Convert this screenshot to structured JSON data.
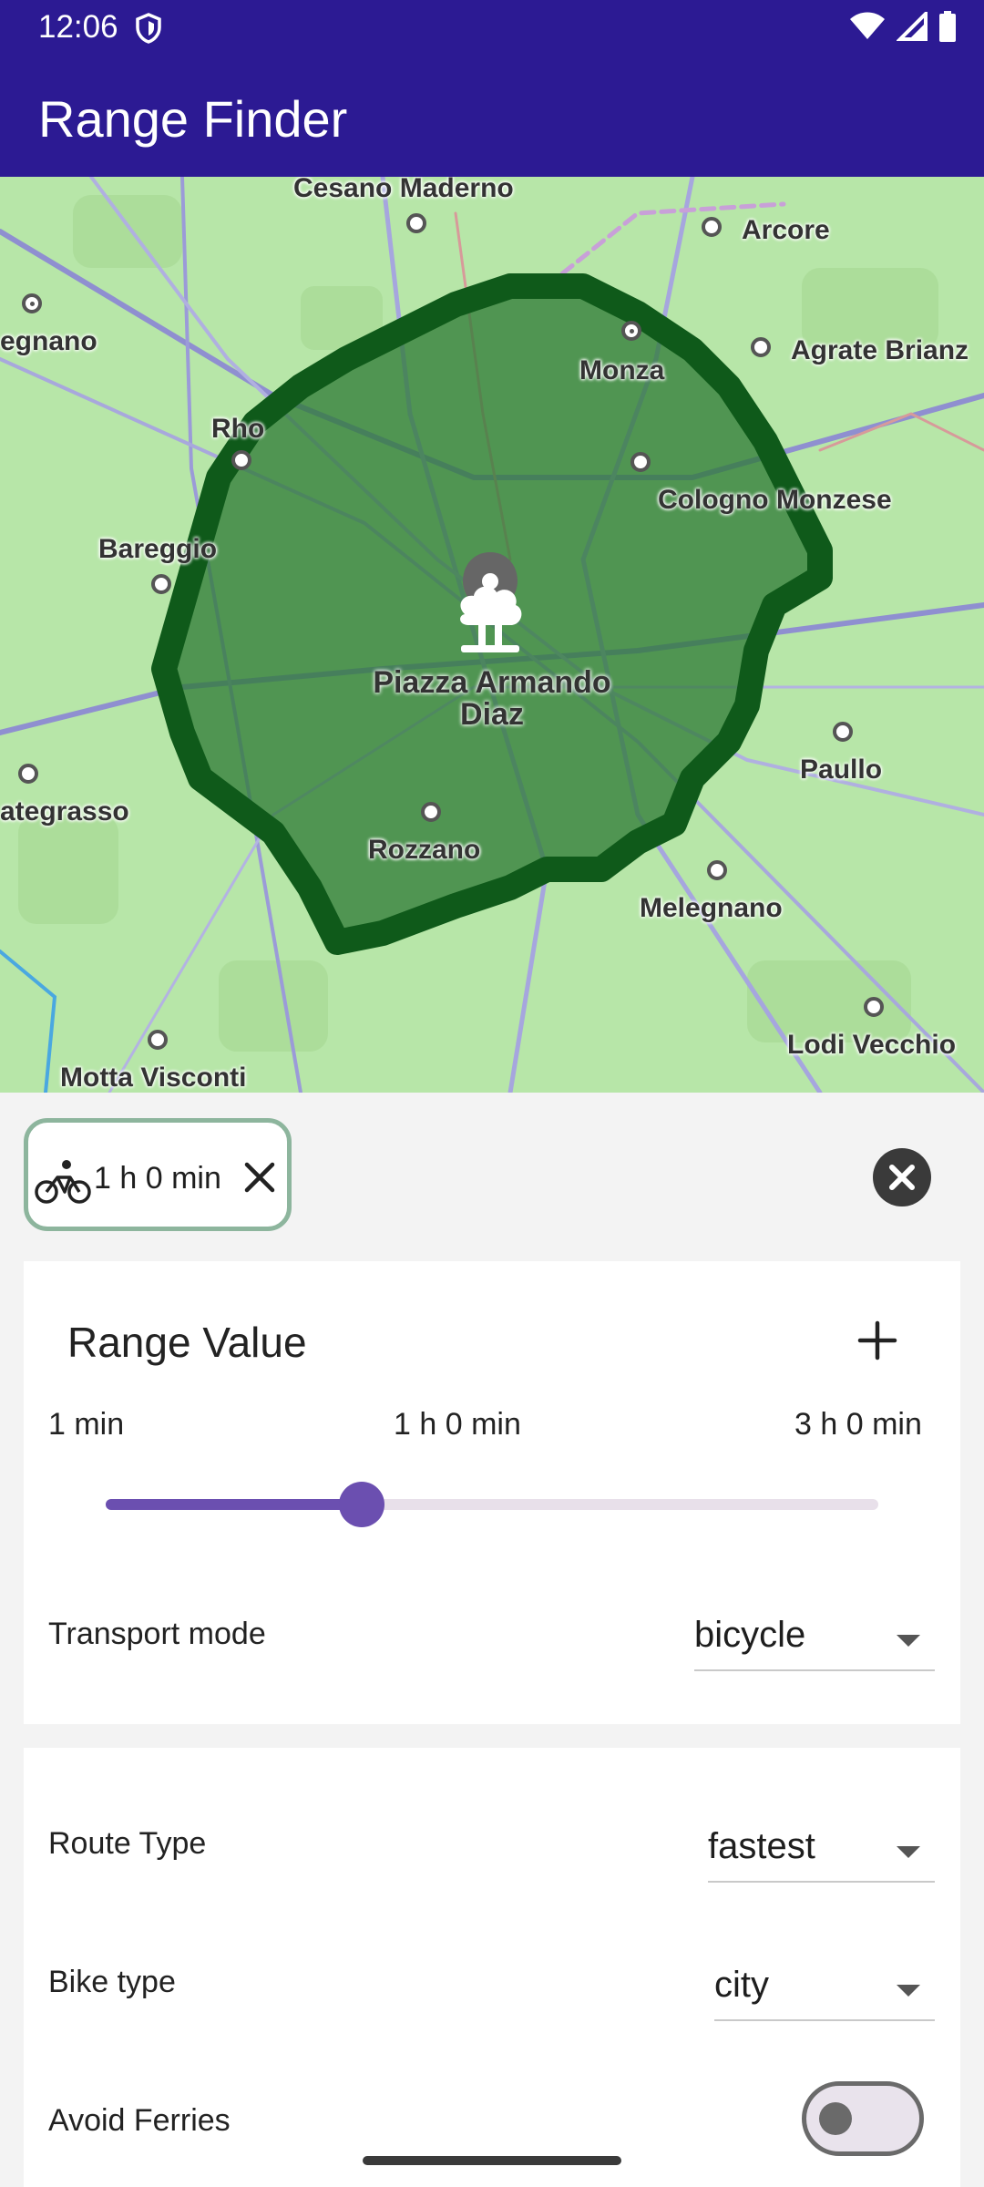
{
  "status_bar": {
    "time": "12:06"
  },
  "app_bar": {
    "title": "Range Finder"
  },
  "map": {
    "center_place": "Piazza Armando Diaz",
    "colors": {
      "isochrone_fill": "#2d7a35",
      "isochrone_border": "#0f5a1a",
      "land": "#b7e6a8"
    },
    "places": [
      {
        "label": "Cesano Maderno"
      },
      {
        "label": "Arcore"
      },
      {
        "label": "egnano"
      },
      {
        "label": "Monza"
      },
      {
        "label": "Agrate Brianz"
      },
      {
        "label": "Rho"
      },
      {
        "label": "Cologno Monzese"
      },
      {
        "label": "Bareggio"
      },
      {
        "label": "Paullo"
      },
      {
        "label": "ategrasso"
      },
      {
        "label": "Rozzano"
      },
      {
        "label": "Melegnano"
      },
      {
        "label": "Lodi Vecchio"
      },
      {
        "label": "Motta Visconti"
      }
    ]
  },
  "chip": {
    "icon": "bicycle-icon",
    "label": "1 h 0 min",
    "close_icon": "close-icon"
  },
  "clear_button": {
    "icon": "clear-circle-icon"
  },
  "range_card": {
    "title": "Range Value",
    "add_icon": "plus-icon",
    "min_label": "1 min",
    "current_label": "1 h 0 min",
    "max_label": "3 h 0 min",
    "slider": {
      "min_minutes": 1,
      "max_minutes": 180,
      "value_minutes": 60,
      "color": "#6b4fb0"
    },
    "transport_mode": {
      "label": "Transport mode",
      "value": "bicycle"
    }
  },
  "route_card": {
    "route_type": {
      "label": "Route Type",
      "value": "fastest"
    },
    "bike_type": {
      "label": "Bike type",
      "value": "city"
    },
    "avoid_ferries": {
      "label": "Avoid Ferries",
      "enabled": false
    }
  }
}
